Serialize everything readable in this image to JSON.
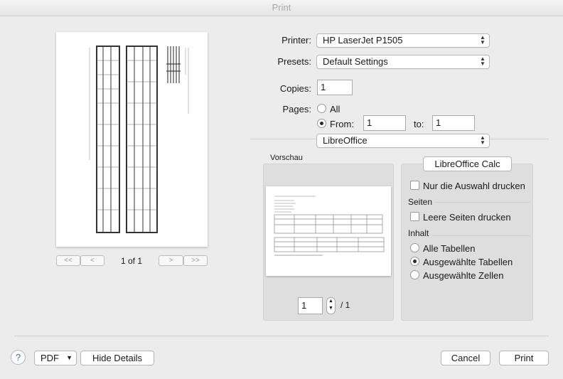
{
  "window": {
    "title": "Print"
  },
  "preview_nav": {
    "first": "<<",
    "prev": "<",
    "page_info": "1 of 1",
    "next": ">",
    "last": ">>"
  },
  "printer": {
    "label": "Printer:",
    "value": "HP LaserJet P1505"
  },
  "presets": {
    "label": "Presets:",
    "value": "Default Settings"
  },
  "copies": {
    "label": "Copies:",
    "value": "1"
  },
  "pages": {
    "label": "Pages:",
    "all_label": "All",
    "from_label": "From:",
    "from_value": "1",
    "to_label": "to:",
    "to_value": "1"
  },
  "section_popup": {
    "value": "LibreOffice"
  },
  "vorschau": {
    "label": "Vorschau",
    "page_value": "1",
    "page_total": "/ 1"
  },
  "calc": {
    "tab_label": "LibreOffice Calc",
    "selection_only": "Nur die Auswahl drucken",
    "seiten_heading": "Seiten",
    "empty_pages": "Leere Seiten drucken",
    "inhalt_heading": "Inhalt",
    "options": [
      "Alle Tabellen",
      "Ausgewählte Tabellen",
      "Ausgewählte Zellen"
    ],
    "selected_index": 1
  },
  "footer": {
    "help": "?",
    "pdf_label": "PDF",
    "hide_details": "Hide Details",
    "cancel": "Cancel",
    "print": "Print"
  }
}
